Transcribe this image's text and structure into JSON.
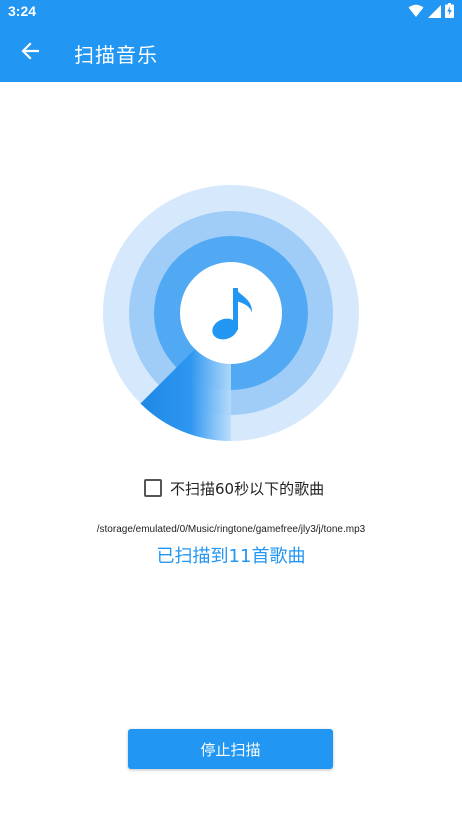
{
  "status_bar": {
    "time": "3:24",
    "icons": [
      "wifi-icon",
      "cell-signal-icon",
      "battery-charging-icon"
    ]
  },
  "app_bar": {
    "title": "扫描音乐",
    "back_icon": "arrow-left-icon",
    "background": "#2196F3"
  },
  "scanner": {
    "center_icon": "music-note-icon",
    "colors": {
      "outer_ring": "#D6E9FC",
      "middle_ring": "#9FCDF7",
      "inner_ring": "#51A9F3",
      "center": "#FFFFFF",
      "note": "#2196F3"
    }
  },
  "filter": {
    "label": "不扫描60秒以下的歌曲",
    "checked": false
  },
  "scan": {
    "current_path": "/storage/emulated/0/Music/ringtone/gamefree/jly3/j/tone.mp3",
    "count_text": "已扫描到11首歌曲"
  },
  "actions": {
    "stop_label": "停止扫描"
  },
  "colors": {
    "accent": "#2196F3"
  }
}
